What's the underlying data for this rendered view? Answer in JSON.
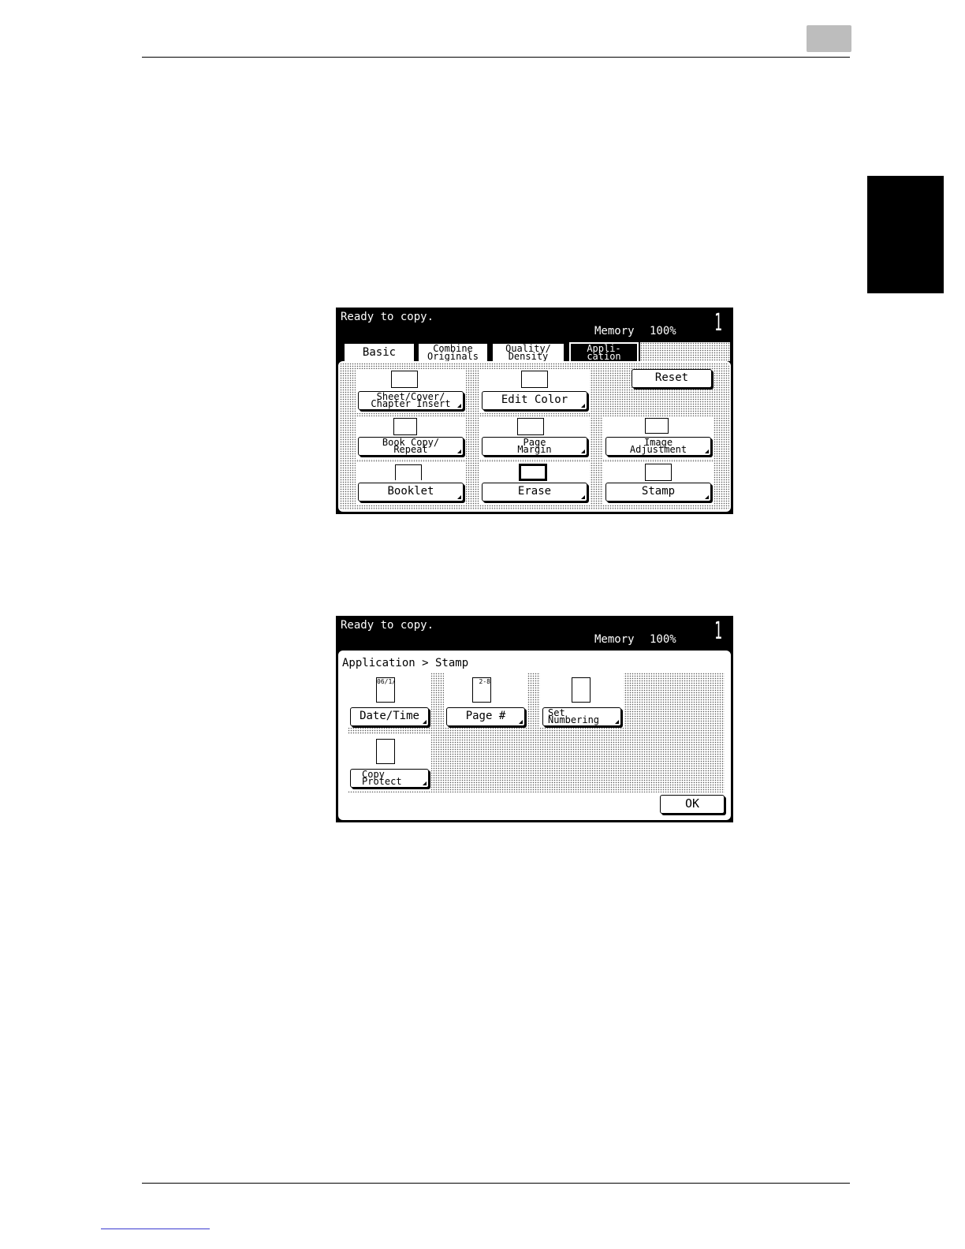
{
  "screen1": {
    "status": {
      "ready": "Ready to copy.",
      "memory_label": "Memory",
      "memory_value": "100%",
      "copies": "1"
    },
    "tabs": [
      {
        "line1": "Basic",
        "line2": ""
      },
      {
        "line1": "Combine",
        "line2": "Originals"
      },
      {
        "line1": "Quality/",
        "line2": "Density"
      },
      {
        "line1": "Appli-",
        "line2": "cation"
      }
    ],
    "buttons": {
      "sheet_cover": {
        "line1": "Sheet/Cover/",
        "line2": "Chapter Insert"
      },
      "edit_color": "Edit Color",
      "reset": "Reset",
      "book_copy": {
        "line1": "Book Copy/",
        "line2": "Repeat"
      },
      "page_margin": {
        "line1": "Page",
        "line2": "Margin"
      },
      "image_adjustment": {
        "line1": "Image",
        "line2": "Adjustment"
      },
      "booklet": "Booklet",
      "erase": "Erase",
      "stamp": "Stamp"
    }
  },
  "screen2": {
    "status": {
      "ready": "Ready to copy.",
      "memory_label": "Memory",
      "memory_value": "100%",
      "copies": "1"
    },
    "breadcrumb": "Application > Stamp",
    "buttons": {
      "date_time": "Date/Time",
      "page_number": "Page #",
      "set_numbering": {
        "line1": "Set",
        "line2": "Numbering"
      },
      "copy_protect": {
        "line1": "Copy",
        "line2": "Protect"
      },
      "ok": "OK"
    },
    "icons": {
      "date_time": "06/1/28",
      "page_number": "2-8"
    }
  }
}
